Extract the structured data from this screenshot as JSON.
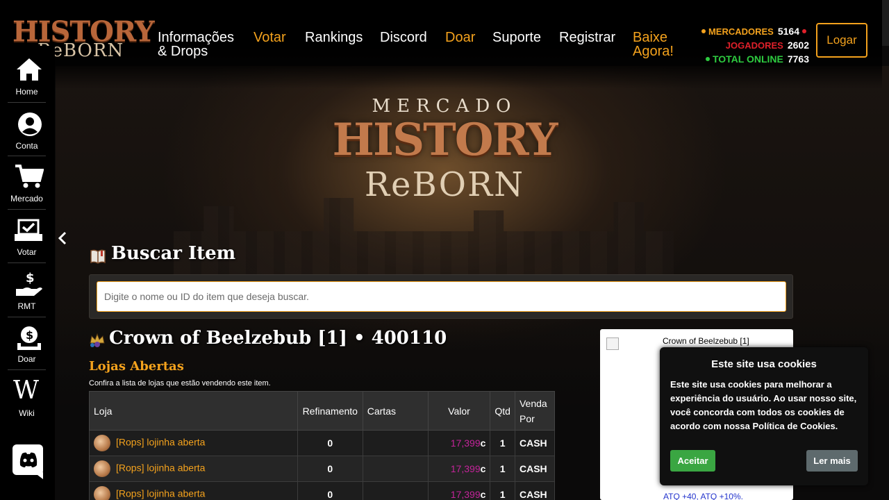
{
  "brand": {
    "logo_line1": "HISTORY",
    "logo_line2": "ReBORN"
  },
  "nav": {
    "items": [
      {
        "label_line1": "Informações",
        "label_line2": "& Drops"
      },
      {
        "label": "Votar"
      },
      {
        "label": "Rankings"
      },
      {
        "label": "Discord"
      },
      {
        "label": "Doar"
      },
      {
        "label": "Suporte"
      },
      {
        "label": "Registrar"
      },
      {
        "label_line1": "Baixe",
        "label_line2": "Agora!"
      }
    ],
    "login_label": "Logar"
  },
  "stats": {
    "merchants_label": "MERCADORES",
    "merchants_value": "5164",
    "players_label": "JOGADORES",
    "players_value": "2602",
    "total_label": "TOTAL ONLINE",
    "total_value": "7763"
  },
  "sidebar": {
    "items": [
      {
        "label": "Home"
      },
      {
        "label": "Conta"
      },
      {
        "label": "Mercado"
      },
      {
        "label": "Votar"
      },
      {
        "label": "RMT"
      },
      {
        "label": "Doar"
      },
      {
        "label": "Wiki"
      }
    ]
  },
  "banner": {
    "line1": "MERCADO",
    "line2": "HISTORY",
    "line3": "ReBORN"
  },
  "search": {
    "title": "Buscar Item",
    "placeholder": "Digite o nome ou ID do item que deseja buscar."
  },
  "item": {
    "title": "Crown of Beelzebub [1] • 400110",
    "card_name": "Crown of Beelzebub [1]",
    "card_bonus": "ATQ +40, ATQ +10%."
  },
  "shops": {
    "title": "Lojas Abertas",
    "description": "Confira a lista de lojas que estão vendendo este item.",
    "columns": {
      "shop": "Loja",
      "refine": "Refinamento",
      "cards": "Cartas",
      "price": "Valor",
      "qty": "Qtd",
      "sale_line1": "Venda",
      "sale_line2": "Por"
    },
    "rows": [
      {
        "shop": "[Rops] lojinha aberta",
        "refine": "0",
        "cards": "",
        "price": "17,399",
        "price_suffix": "c",
        "qty": "1",
        "sale": "CASH"
      },
      {
        "shop": "[Rops] lojinha aberta",
        "refine": "0",
        "cards": "",
        "price": "17,399",
        "price_suffix": "c",
        "qty": "1",
        "sale": "CASH"
      },
      {
        "shop": "[Rops] lojinha aberta",
        "refine": "0",
        "cards": "",
        "price": "17,399",
        "price_suffix": "c",
        "qty": "1",
        "sale": "CASH"
      }
    ]
  },
  "cookie": {
    "title": "Este site usa cookies",
    "text": "Este site usa cookies para melhorar a experiência do usuário. Ao usar nosso site, você concorda com todos os cookies de acordo com nossa Política de Cookies.",
    "accept": "Aceitar",
    "more": "Ler mais"
  },
  "colors": {
    "accent": "#f4a21d",
    "price": "#c4249a",
    "online": "#2ecc40",
    "players": "#e0202a"
  }
}
